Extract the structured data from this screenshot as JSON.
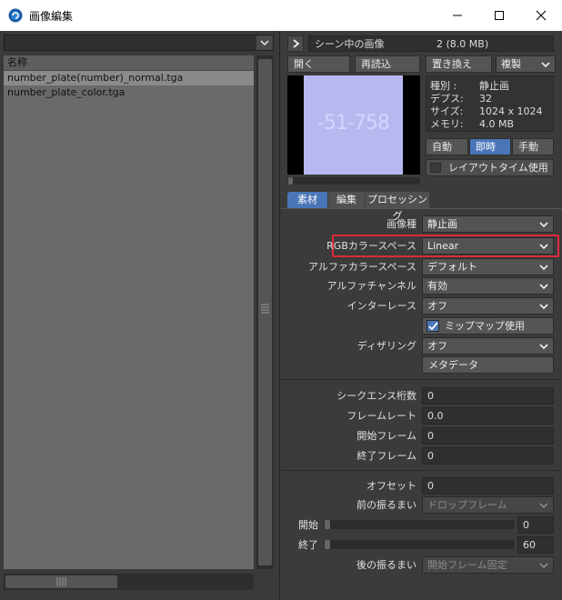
{
  "window": {
    "title": "画像編集"
  },
  "left": {
    "list_header": "名称",
    "files": [
      "number_plate(number)_normal.tga",
      "number_plate_color.tga"
    ]
  },
  "top": {
    "scene_label": "シーン中の画像",
    "scene_count": "2 (8.0 MB)",
    "buttons": {
      "open": "開く",
      "reload": "再読込",
      "replace": "置き換え",
      "duplicate": "複製"
    },
    "preview_text": "-51-758",
    "info": [
      {
        "key": "種別 :",
        "val": "静止画"
      },
      {
        "key": "デプス:",
        "val": "32"
      },
      {
        "key": "サイズ:",
        "val": "1024 x 1024"
      },
      {
        "key": "メモリ:",
        "val": "4.0 MB"
      }
    ],
    "mode_buttons": [
      "自動",
      "即時",
      "手動"
    ],
    "mode_selected": "即時",
    "layout_time": "レイアウトタイム使用"
  },
  "tabs": [
    "素材",
    "編集",
    "プロセッシング"
  ],
  "props": {
    "image_type": {
      "label": "画像種",
      "value": "静止画"
    },
    "rgb_colorspace": {
      "label": "RGBカラースペース",
      "value": "Linear"
    },
    "alpha_colorspace": {
      "label": "アルファカラースペース",
      "value": "デフォルト"
    },
    "alpha_channel": {
      "label": "アルファチャンネル",
      "value": "有効"
    },
    "interlace": {
      "label": "インターレース",
      "value": "オフ"
    },
    "mipmap": {
      "label": "ミップマップ使用",
      "checked": true
    },
    "dithering": {
      "label": "ディザリング",
      "value": "オフ"
    },
    "metadata": "メタデータ"
  },
  "sequence": {
    "digits": {
      "label": "シークエンス桁数",
      "value": "0"
    },
    "framerate": {
      "label": "フレームレート",
      "value": "0.0"
    },
    "start": {
      "label": "開始フレーム",
      "value": "0"
    },
    "end": {
      "label": "終了フレーム",
      "value": "0"
    }
  },
  "offset": {
    "offset": {
      "label": "オフセット",
      "value": "0"
    },
    "pre": {
      "label": "前の振るまい",
      "value": "ドロップフレーム"
    },
    "start": {
      "label": "開始",
      "value": "0"
    },
    "end": {
      "label": "終了",
      "value": "60"
    },
    "post": {
      "label": "後の振るまい",
      "value": "開始フレーム固定"
    }
  },
  "colors": {
    "accent": "#4a90d9",
    "highlight": "#e0283a",
    "preview_bg": "#b8b8f0"
  }
}
